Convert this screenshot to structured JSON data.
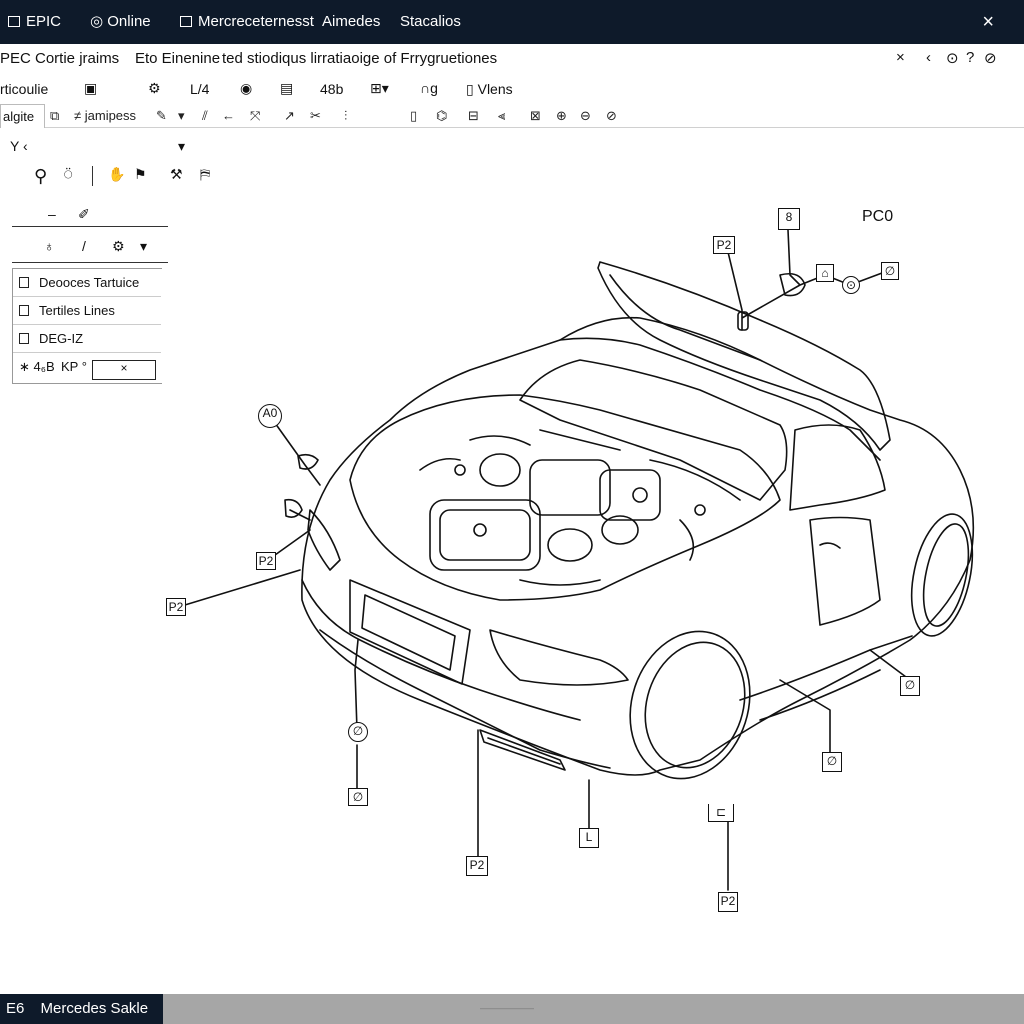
{
  "titlebar": {
    "app": "EPIC",
    "online": "Online",
    "tab1": "Mercreceternesst",
    "tab2": "Aimedes",
    "tab3": "Stacalios",
    "close": "×"
  },
  "menubar": {
    "title": "PEC Cortie jraims",
    "item1": "Eto Einenine",
    "item2": "ted stiodiqus lirratiaoige of Frrygruetiones",
    "controls": [
      "×",
      "‹",
      "⊙",
      "?",
      "⊘"
    ]
  },
  "toolbar": {
    "label": "rticoulie",
    "val1": "L/4",
    "val2": "48b",
    "val3": "Vlens"
  },
  "toolbar2": {
    "tab": "algite",
    "text": "≠ jamipess"
  },
  "leftpanel": {
    "row1": "Y  ‹",
    "dropdown_glyph": "▾",
    "list": [
      {
        "label": "Deooces Tartuice"
      },
      {
        "label": "Tertiles Lines"
      },
      {
        "label": "DEG-IZ"
      }
    ],
    "footer_left": "∗ 4₆B",
    "footer_mid": "KP °",
    "input_value": "×"
  },
  "callouts": {
    "c1": "8",
    "c2": "P2",
    "c3": "PC0",
    "c4": "A0",
    "c5": "P2",
    "c6": "P2",
    "c7": "L",
    "c8": "P2",
    "c9": "P2"
  },
  "statusbar": {
    "code": "E6",
    "label": "Mercedes Sakle",
    "mid": "——————"
  }
}
